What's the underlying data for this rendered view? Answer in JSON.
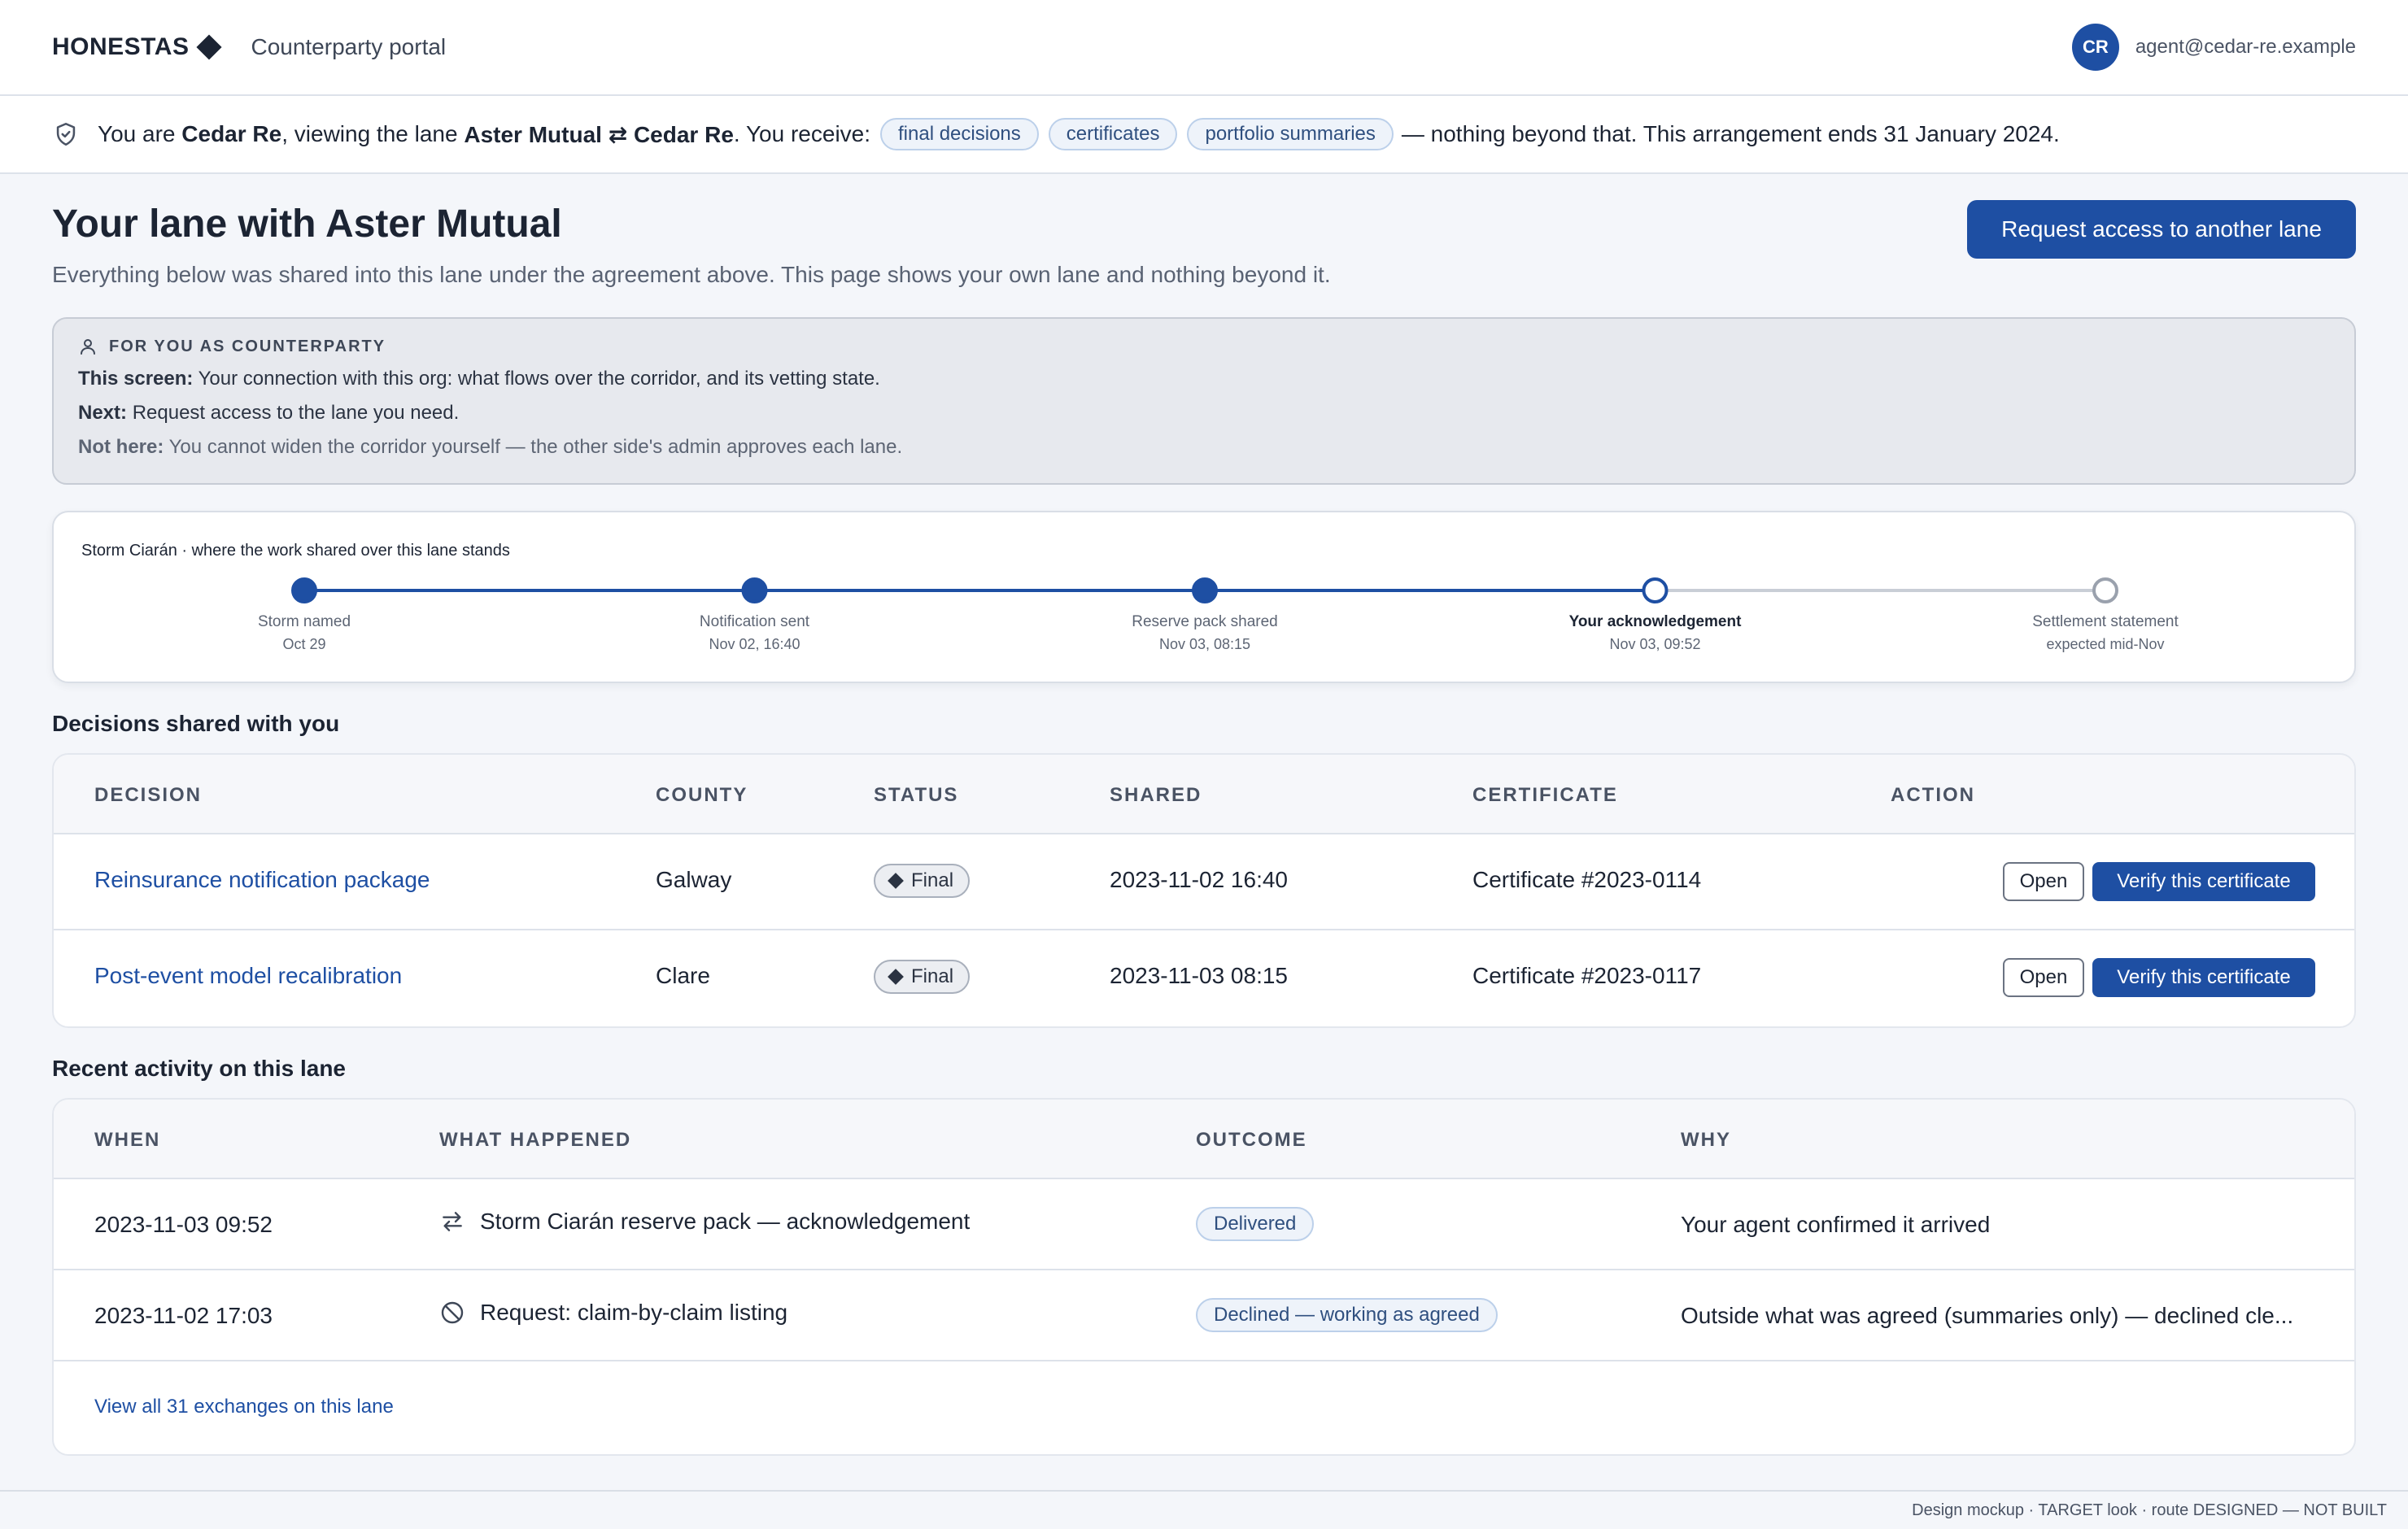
{
  "header": {
    "brand": "HONESTAS",
    "portal": "Counterparty portal",
    "avatar_initials": "CR",
    "user_email": "agent@cedar-re.example"
  },
  "scope": {
    "prefix": "You are ",
    "org": "Cedar Re",
    "mid": ", viewing the lane ",
    "lane": "Aster Mutual ⇄ Cedar Re",
    "receive": ". You receive:",
    "chips": [
      "final decisions",
      "certificates",
      "portfolio summaries"
    ],
    "suffix": "— nothing beyond that. This arrangement ends 31 January 2024."
  },
  "page": {
    "title": "Your lane with Aster Mutual",
    "subtitle": "Everything below was shared into this lane under the agreement above. This page shows your own lane and nothing beyond it.",
    "request_button": "Request access to another lane"
  },
  "helper": {
    "heading": "FOR YOU AS COUNTERPARTY",
    "screen_label": "This screen:",
    "screen_text": "Your connection with this org: what flows over the corridor, and its vetting state.",
    "next_label": "Next:",
    "next_text": "Request access to the lane you need.",
    "nothere_label": "Not here:",
    "nothere_text": "You cannot widen the corridor yourself — the other side's admin approves each lane."
  },
  "timeline": {
    "title": "Storm Ciarán · where the work shared over this lane stands",
    "steps": [
      {
        "label": "Storm named",
        "date": "Oct 29",
        "state": "done"
      },
      {
        "label": "Notification sent",
        "date": "Nov 02, 16:40",
        "state": "done"
      },
      {
        "label": "Reserve pack shared",
        "date": "Nov 03, 08:15",
        "state": "done"
      },
      {
        "label": "Your acknowledgement",
        "date": "Nov 03, 09:52",
        "state": "current"
      },
      {
        "label": "Settlement statement",
        "date": "expected mid-Nov",
        "state": "pending"
      }
    ]
  },
  "decisions": {
    "heading": "Decisions shared with you",
    "columns": [
      "DECISION",
      "COUNTY",
      "STATUS",
      "SHARED",
      "CERTIFICATE",
      "ACTION"
    ],
    "rows": [
      {
        "decision": "Reinsurance notification package",
        "county": "Galway",
        "status": "Final",
        "shared": "2023-11-02 16:40",
        "certificate": "Certificate #2023-0114",
        "open": "Open",
        "verify": "Verify this certificate"
      },
      {
        "decision": "Post-event model recalibration",
        "county": "Clare",
        "status": "Final",
        "shared": "2023-11-03 08:15",
        "certificate": "Certificate #2023-0117",
        "open": "Open",
        "verify": "Verify this certificate"
      }
    ]
  },
  "activity": {
    "heading": "Recent activity on this lane",
    "columns": [
      "WHEN",
      "WHAT HAPPENED",
      "OUTCOME",
      "WHY"
    ],
    "rows": [
      {
        "when": "2023-11-03 09:52",
        "icon": "exchange-icon",
        "what": "Storm Ciarán reserve pack — acknowledgement",
        "outcome": "Delivered",
        "why": "Your agent confirmed it arrived"
      },
      {
        "when": "2023-11-02 17:03",
        "icon": "blocked-icon",
        "what": "Request: claim-by-claim listing",
        "outcome": "Declined — working as agreed",
        "why": "Outside what was agreed (summaries only) — declined cle..."
      }
    ],
    "view_all": "View all 31 exchanges on this lane"
  },
  "footer": {
    "note": "Design mockup · TARGET look · route DESIGNED — NOT BUILT"
  },
  "colors": {
    "accent": "#1e4fa3",
    "pending": "#9aa1ad"
  }
}
